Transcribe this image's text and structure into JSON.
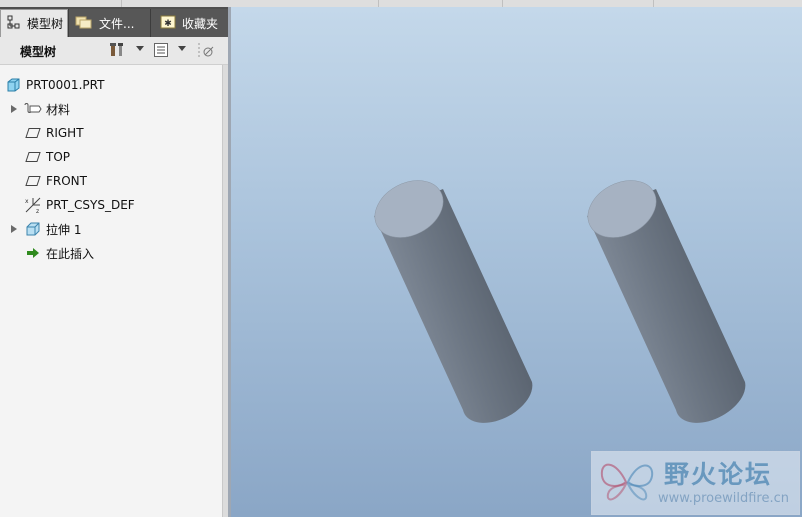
{
  "tabs": [
    {
      "label": "模型树",
      "icon": "model-tree-icon"
    },
    {
      "label": "文件...",
      "icon": "folder-icon"
    },
    {
      "label": "收藏夹",
      "icon": "favorites-icon"
    }
  ],
  "toolbar": {
    "title": "模型树",
    "icons": [
      "settings-tools-icon",
      "show-columns-icon",
      "filter-icon"
    ]
  },
  "tree": {
    "root": {
      "label": "PRT0001.PRT",
      "icon": "part-icon"
    },
    "items": [
      {
        "label": "材料",
        "icon": "material-icon",
        "expandable": true
      },
      {
        "label": "RIGHT",
        "icon": "datum-plane-icon",
        "expandable": false
      },
      {
        "label": "TOP",
        "icon": "datum-plane-icon",
        "expandable": false
      },
      {
        "label": "FRONT",
        "icon": "datum-plane-icon",
        "expandable": false
      },
      {
        "label": "PRT_CSYS_DEF",
        "icon": "coordinate-system-icon",
        "expandable": false
      },
      {
        "label": "拉伸 1",
        "icon": "extrude-icon",
        "expandable": true
      },
      {
        "label": "在此插入",
        "icon": "insert-here-arrow-icon",
        "expandable": false
      }
    ]
  },
  "viewport": {
    "model": "two-cylinders",
    "background_top": "#c4d8ea",
    "background_bottom": "#8aa6c6"
  },
  "watermark": {
    "title": "野火论坛",
    "url": "www.proewildfire.cn"
  }
}
